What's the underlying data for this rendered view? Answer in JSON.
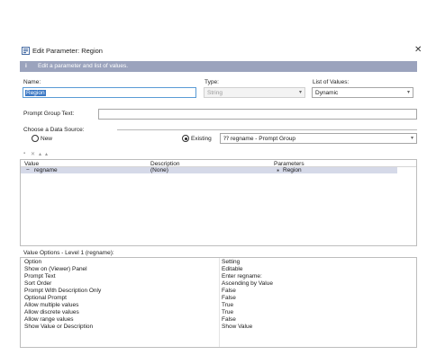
{
  "window": {
    "title": "Edit Parameter: Region",
    "banner_icon": "i",
    "banner_text": "Edit a parameter and list of values."
  },
  "fields": {
    "name_label": "Name:",
    "name_value": "Region",
    "type_label": "Type:",
    "type_value": "String",
    "lov_label": "List of Values:",
    "lov_value": "Dynamic",
    "prompt_group_label": "Prompt Group Text:",
    "prompt_group_value": ""
  },
  "datasource": {
    "label": "Choose a Data Source:",
    "new_label": "New",
    "existing_label": "Existing",
    "existing_value": "⁇ regname - Prompt Group",
    "selected": "existing"
  },
  "toolbar": {
    "icons": [
      "delete-icon",
      "remove-icon",
      "move-up-icon",
      "move-down-icon"
    ]
  },
  "values_table": {
    "headers": [
      "Value",
      "Description",
      "Parameters"
    ],
    "rows": [
      {
        "value": "regname",
        "description": "(None)",
        "parameters": "Region"
      }
    ]
  },
  "options": {
    "title": "Value Options - Level 1 (regname):",
    "headers": [
      "Option",
      "Setting"
    ],
    "rows": [
      {
        "option": "Show on (Viewer) Panel",
        "setting": "Editable"
      },
      {
        "option": "Prompt Text",
        "setting": "Enter regname:"
      },
      {
        "option": "Sort Order",
        "setting": "Ascending by Value"
      },
      {
        "option": "Prompt With Description Only",
        "setting": "False"
      },
      {
        "option": "Optional Prompt",
        "setting": "False"
      },
      {
        "option": "Allow multiple values",
        "setting": "True"
      },
      {
        "option": "Allow discrete values",
        "setting": "True"
      },
      {
        "option": "Allow range values",
        "setting": "False"
      },
      {
        "option": "Show Value or Description",
        "setting": "Show Value"
      }
    ]
  },
  "colors": {
    "banner": "#9ba3bd",
    "selection": "#3b78c4",
    "row_highlight": "#d5d9e8"
  }
}
